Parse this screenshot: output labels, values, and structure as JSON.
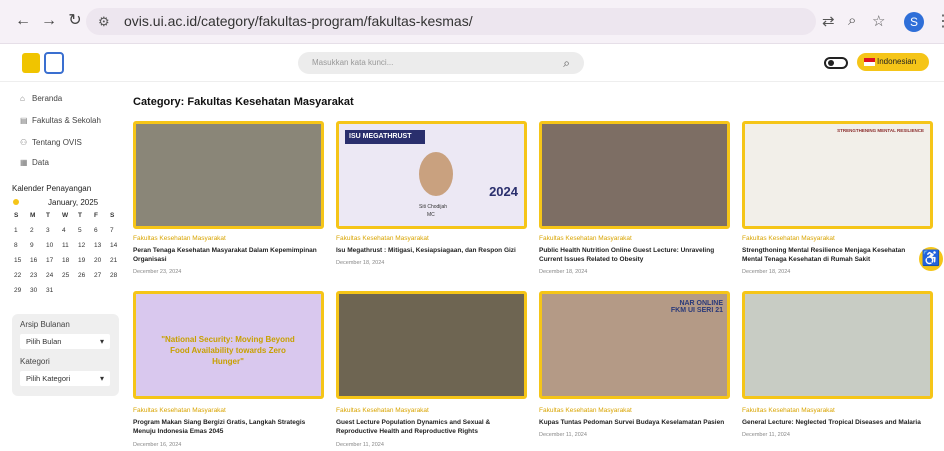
{
  "browser": {
    "url": "ovis.ui.ac.id/category/fakultas-program/fakultas-kesmas/",
    "avatar": "S"
  },
  "header": {
    "search_placeholder": "Masukkan kata kunci...",
    "language": "Indonesian"
  },
  "sidebar": {
    "items": [
      {
        "icon": "home-icon",
        "label": "Beranda"
      },
      {
        "icon": "building-icon",
        "label": "Fakultas & Sekolah"
      },
      {
        "icon": "user-icon",
        "label": "Tentang OVIS"
      },
      {
        "icon": "document-icon",
        "label": "Data"
      }
    ],
    "calendar_title": "Kalender Penayangan",
    "month": "January, 2025",
    "weekdays": [
      "S",
      "M",
      "T",
      "W",
      "T",
      "F",
      "S"
    ],
    "weeks": [
      [
        "1",
        "2",
        "3",
        "4",
        "5",
        "6",
        "7"
      ],
      [
        "8",
        "9",
        "10",
        "11",
        "12",
        "13",
        "14"
      ],
      [
        "15",
        "16",
        "17",
        "18",
        "19",
        "20",
        "21"
      ],
      [
        "22",
        "23",
        "24",
        "25",
        "26",
        "27",
        "28"
      ],
      [
        "29",
        "30",
        "31",
        "",
        "",
        "",
        ""
      ]
    ],
    "archive_label": "Arsip Bulanan",
    "archive_value": "Pilih Bulan",
    "category_label": "Kategori",
    "category_value": "Pilih Kategori"
  },
  "main": {
    "title": "Category: Fakultas Kesehatan Masyarakat",
    "cards": [
      {
        "category": "Fakultas Kesehatan Masyarakat",
        "title": "Peran Tenaga Kesehatan Masyarakat Dalam Kepemimpinan Organisasi",
        "date": "December 23, 2024",
        "bg": "#8a8678"
      },
      {
        "category": "Fakultas Kesehatan Masyarakat",
        "title": "Isu Megathrust : Mitigasi, Kesiapsiagaan, dan Respon Gizi",
        "date": "December 18, 2024",
        "bg": "#ece8f4",
        "thumb_text": "ISU MEGATHRUST",
        "thumb_year": "2024",
        "speaker": "Siti Chodijah",
        "role": "MC"
      },
      {
        "category": "Fakultas Kesehatan Masyarakat",
        "title": "Public Health Nutrition Online Guest Lecture: Unraveling Current Issues Related to Obesity",
        "date": "December 18, 2024",
        "bg": "#7d6e64"
      },
      {
        "category": "Fakultas Kesehatan Masyarakat",
        "title": "Strengthoning Mental Resilience Menjaga Kesehatan Mental Tenaga Kesehatan di Rumah Sakit",
        "date": "December 18, 2024",
        "bg": "#f2efe9",
        "thumb_text": "STRENGTHENING MENTAL RESILIENCE"
      },
      {
        "category": "Fakultas Kesehatan Masyarakat",
        "title": "Program Makan Siang Bergizi Gratis, Langkah Strategis Menuju Indonesia Emas 2045",
        "date": "December 16, 2024",
        "bg": "#d9c8ee",
        "thumb_text": "\"National Security: Moving Beyond Food Availability towards Zero Hunger\""
      },
      {
        "category": "Fakultas Kesehatan Masyarakat",
        "title": "Guest Lecture Population Dynamics and Sexual & Reproductive Health and Reproductive Rights",
        "date": "December 11, 2024",
        "bg": "#6e6552"
      },
      {
        "category": "Fakultas Kesehatan Masyarakat",
        "title": "Kupas Tuntas Pedoman Survei Budaya Keselamatan Pasien",
        "date": "December 11, 2024",
        "bg": "#b49a86",
        "thumb_text": "NAR ONLINE FKM UI SERI 21"
      },
      {
        "category": "Fakultas Kesehatan Masyarakat",
        "title": "General Lecture: Neglected Tropical Diseases and Malaria",
        "date": "December 11, 2024",
        "bg": "#c8ccc4"
      }
    ]
  }
}
